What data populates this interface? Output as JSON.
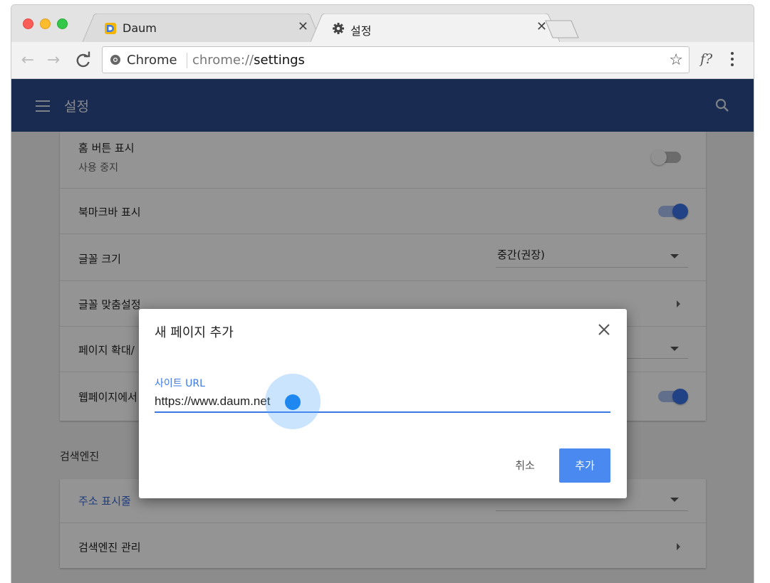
{
  "browser": {
    "tabs": [
      {
        "title": "Daum"
      },
      {
        "title": "설정"
      }
    ],
    "omnibox": {
      "chip": "Chrome",
      "url_scheme": "chrome://",
      "url_path": "settings"
    },
    "extension_label": "f?"
  },
  "appbar": {
    "title": "설정"
  },
  "settings": {
    "rows": [
      {
        "label": "홈 버튼 표시",
        "sub": "사용 중지",
        "toggle": "off"
      },
      {
        "label": "북마크바 표시",
        "toggle": "on"
      },
      {
        "label": "글꼴 크기",
        "value": "중간(권장)"
      },
      {
        "label": "글꼴 맞춤설정"
      },
      {
        "label": "페이지 확대/"
      },
      {
        "label": "웹페이지에서",
        "toggle": "on"
      }
    ],
    "section_search": "검색엔진",
    "search_rows": [
      {
        "label": "주소 표시줄"
      },
      {
        "label": "검색엔진 관리"
      }
    ]
  },
  "dialog": {
    "title": "새 페이지 추가",
    "field_label": "사이트 URL",
    "field_value": "https://www.daum.net",
    "cancel_label": "취소",
    "add_label": "추가"
  },
  "colors": {
    "appbar": "#2c4a8a",
    "accent": "#3a78e6",
    "add_button": "#4a8af0"
  }
}
